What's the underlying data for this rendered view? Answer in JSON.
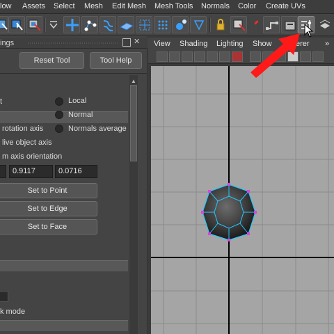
{
  "menubar": {
    "items": [
      "low",
      "Assets",
      "Select",
      "Mesh",
      "Edit Mesh",
      "Mesh Tools",
      "Normals",
      "Color",
      "Create UVs"
    ]
  },
  "tool_panel": {
    "title": "ings",
    "reset_label": "Reset Tool",
    "help_label": "Tool Help",
    "options": {
      "local": "Local",
      "normal": "Normal",
      "rotation_axis": "rotation axis",
      "normals_average": "Normals average",
      "live_object_axis": "live object axis",
      "axis_orientation": "m axis orientation"
    },
    "values": [
      "0.9117",
      "0.0716"
    ],
    "set_to_point": "Set to Point",
    "set_to_edge": "Set to Edge",
    "set_to_face": "Set to Face",
    "mode_label": "k mode"
  },
  "viewport": {
    "menu": [
      "View",
      "Shading",
      "Lighting",
      "Show",
      "erer"
    ]
  },
  "colors": {
    "annotation_arrow": "#ff1a1a",
    "wireframe": "#22c8ff",
    "vertex": "#e040e0"
  },
  "icons": [
    "lasso-icon",
    "paint-select-icon",
    "move-icon",
    "vertex-icon",
    "edge-icon",
    "face-icon",
    "multi-component-icon",
    "uv-icon",
    "lock-icon",
    "magnet-icon",
    "snap-icon",
    "render-icon",
    "transform-constraint-icon",
    "history-icon"
  ]
}
